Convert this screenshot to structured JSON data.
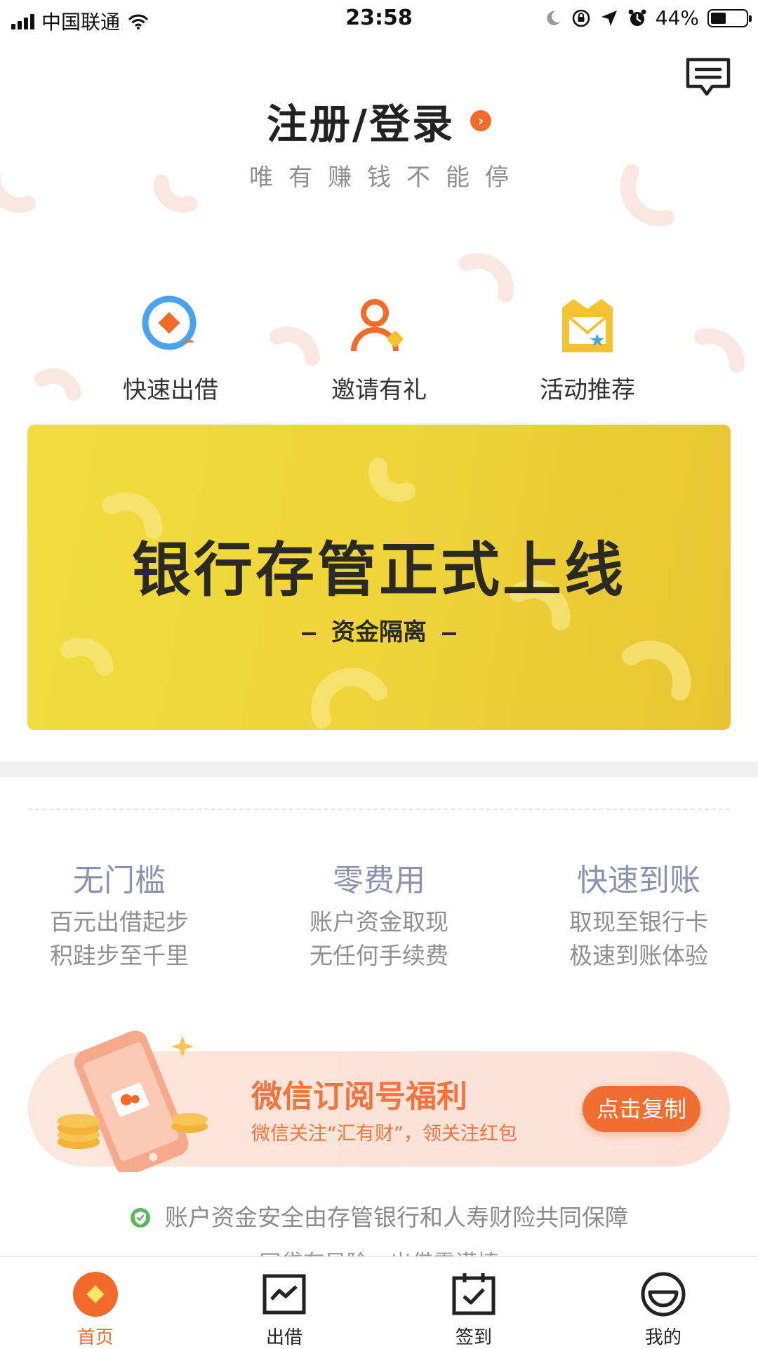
{
  "status_bar": {
    "carrier": "中国联通",
    "time": "23:58",
    "battery": "44%",
    "battery_level": 0.44
  },
  "header": {
    "login_label": "注册/登录",
    "slogan": "唯有赚钱不能停"
  },
  "quick_actions": [
    {
      "label": "快速出借",
      "icon": "quick-lend-icon"
    },
    {
      "label": "邀请有礼",
      "icon": "invite-icon"
    },
    {
      "label": "活动推荐",
      "icon": "activity-icon"
    }
  ],
  "banner": {
    "title": "银行存管正式上线",
    "subtitle": "资金隔离"
  },
  "features": [
    {
      "title": "无门槛",
      "line1": "百元出借起步",
      "line2": "积跬步至千里"
    },
    {
      "title": "零费用",
      "line1": "账户资金取现",
      "line2": "无任何手续费"
    },
    {
      "title": "快速到账",
      "line1": "取现至银行卡",
      "line2": "极速到账体验"
    }
  ],
  "wechat_promo": {
    "title": "微信订阅号福利",
    "subtitle": "微信关注“汇有财”，领关注红包",
    "button": "点击复制"
  },
  "safety_note": "账户资金安全由存管银行和人寿财险共同保障",
  "risk_note": "网贷有风险，出借需谨慎",
  "tabs": [
    {
      "label": "首页",
      "icon": "home-icon",
      "active": true
    },
    {
      "label": "出借",
      "icon": "chart-icon",
      "active": false
    },
    {
      "label": "签到",
      "icon": "checkin-icon",
      "active": false
    },
    {
      "label": "我的",
      "icon": "profile-icon",
      "active": false
    }
  ],
  "colors": {
    "accent": "#f26b2a",
    "banner": "#f0d43a",
    "promo_bg": "#fde6dc"
  }
}
